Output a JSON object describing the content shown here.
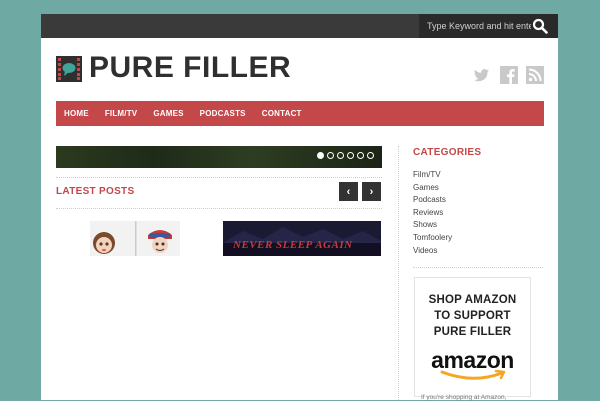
{
  "search": {
    "placeholder": "Type Keyword and hit enter",
    "icon": "search-icon"
  },
  "brand": {
    "logo_text": "PURE FILLER",
    "logo_icon": "film-speech-icon"
  },
  "social": {
    "icons": [
      "twitter-icon",
      "facebook-icon",
      "rss-icon"
    ]
  },
  "nav": {
    "items": [
      {
        "label": "HOME"
      },
      {
        "label": "FILM/TV"
      },
      {
        "label": "GAMES"
      },
      {
        "label": "PODCASTS"
      },
      {
        "label": "CONTACT"
      }
    ]
  },
  "slider": {
    "dot_count": 6,
    "active_index": 0
  },
  "latest": {
    "title": "LATEST POSTS",
    "prev_label": "‹",
    "next_label": "›"
  },
  "posts": [
    {
      "thumb": "cartoon-characters"
    },
    {
      "thumb": "movie-title-art",
      "overlay_text": "NEVER SLEEP AGAIN"
    }
  ],
  "sidebar": {
    "categories_title": "CATEGORIES",
    "categories": [
      "Film/TV",
      "Games",
      "Podcasts",
      "Reviews",
      "Shows",
      "Tomfoolery",
      "Videos"
    ],
    "amazon": {
      "line1": "SHOP AMAZON",
      "line2": "TO SUPPORT",
      "line3": "PURE FILLER",
      "logo": "amazon",
      "caption": "If you're shopping at Amazon,"
    }
  },
  "colors": {
    "accent": "#c4474a",
    "background": "#6fa9a3",
    "topbar": "#3a3a3a"
  }
}
